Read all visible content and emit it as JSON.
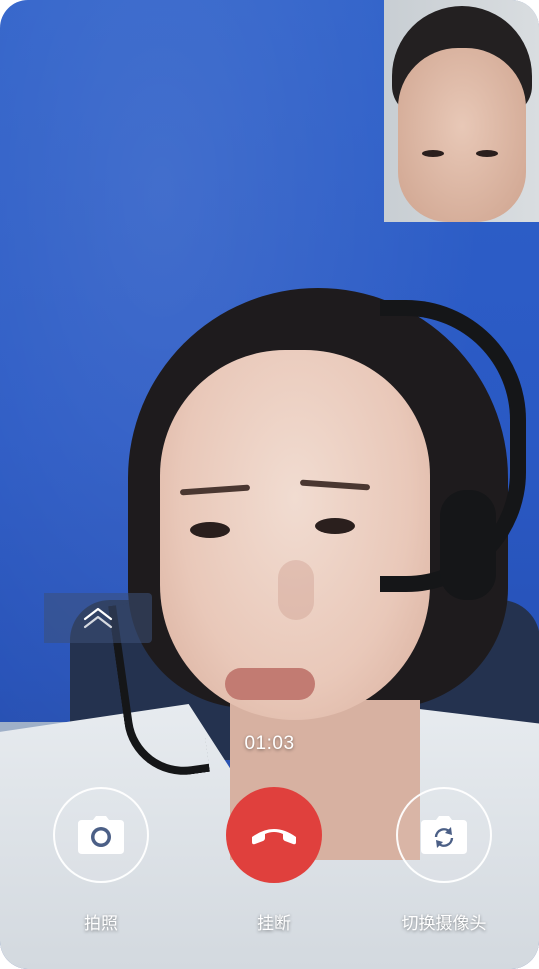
{
  "call": {
    "duration": "01:03"
  },
  "controls": {
    "photo_label": "拍照",
    "hangup_label": "挂断",
    "switch_camera_label": "切换摄像头"
  },
  "icons": {
    "collapse": "chevron-up-icon",
    "photo": "camera-icon",
    "hangup": "phone-hangup-icon",
    "switch_camera": "camera-switch-icon"
  },
  "colors": {
    "hangup": "#e0403d",
    "background_wall": "#2f61c9",
    "text": "#ffffff"
  }
}
